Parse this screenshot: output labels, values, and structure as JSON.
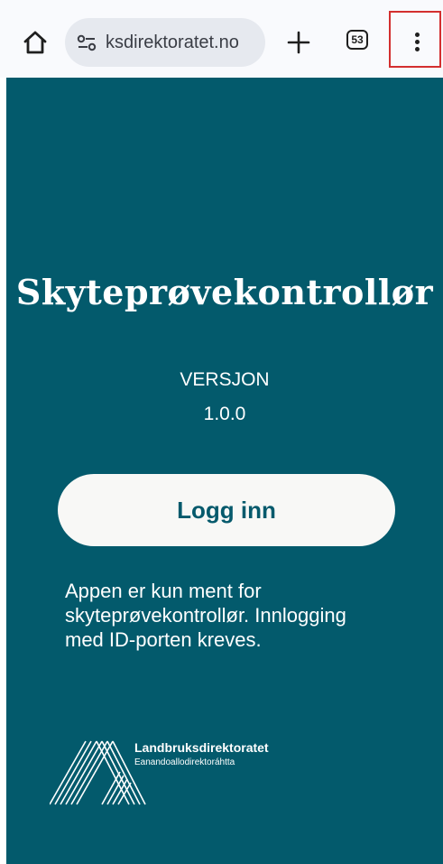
{
  "browser": {
    "url_text": "ksdirektoratet.no",
    "tab_count": "53",
    "icons": {
      "home": "home-icon",
      "site_settings": "site-settings-icon",
      "new_tab": "plus-icon",
      "tabs": "tab-switcher-icon",
      "menu": "more-vert-icon"
    }
  },
  "page": {
    "title": "Skyteprøvekontrollør",
    "version_label": "VERSJON",
    "version_number": "1.0.0",
    "login_button": "Logg inn",
    "notice": "Appen er kun ment for skyteprøvekontrollør. Innlogging med ID-porten kreves.",
    "org_name": "Landbruksdirektoratet",
    "org_subname": "Eanandoallodirektoráhtta"
  },
  "colors": {
    "background": "#035a6c",
    "button_bg": "#f8f8f6",
    "button_text": "#065a6c",
    "highlight": "#d32f2f"
  }
}
